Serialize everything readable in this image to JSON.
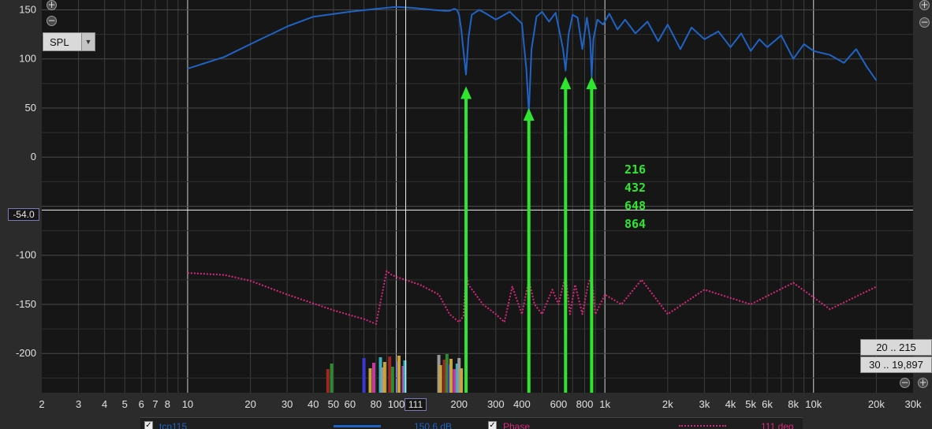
{
  "view_selector": {
    "value": "SPL"
  },
  "cursor_readout": {
    "y_value": "-54.0",
    "x_value": "111"
  },
  "range_buttons": {
    "low_band": "20 .. 215",
    "full_band": "30 .. 19,897"
  },
  "colors": {
    "spl": "#1f63c4",
    "phase": "#d8287b",
    "arrow": "#2fe62f",
    "background": "#161616"
  },
  "legend": {
    "trace_name": "tcp115",
    "trace_level": "150.6 dB",
    "phase_label": "Phase",
    "phase_value": "111 deg"
  },
  "chart_data": {
    "type": "line",
    "x_scale": "log",
    "xlim": [
      2,
      30000
    ],
    "ylim": [
      -240,
      160
    ],
    "x_tick_labels": [
      "2",
      "3",
      "4",
      "5",
      "6",
      "7",
      "8",
      "10",
      "20",
      "30",
      "40",
      "50",
      "60",
      "80",
      "100",
      "200",
      "300",
      "400",
      "600",
      "800",
      "1k",
      "2k",
      "3k",
      "4k",
      "5k",
      "6k",
      "8k",
      "10k",
      "20k",
      "30k"
    ],
    "y_tick_labels": [
      "150",
      "100",
      "50",
      "0",
      "-100",
      "-150",
      "-200"
    ],
    "grid": true,
    "annotations": [
      "216",
      "432",
      "648",
      "864"
    ],
    "arrows": [
      {
        "x": 216,
        "y_from": -240,
        "y_to": 72
      },
      {
        "x": 432,
        "y_from": -240,
        "y_to": 50
      },
      {
        "x": 648,
        "y_from": -240,
        "y_to": 82
      },
      {
        "x": 864,
        "y_from": -240,
        "y_to": 82
      }
    ],
    "series": [
      {
        "style": "solid",
        "x": [
          10,
          15,
          20,
          30,
          40,
          60,
          80,
          100,
          120,
          150,
          170,
          180,
          190,
          195,
          200,
          205,
          210,
          216,
          222,
          230,
          250,
          270,
          300,
          350,
          400,
          420,
          432,
          445,
          470,
          500,
          540,
          580,
          610,
          630,
          648,
          670,
          700,
          740,
          780,
          820,
          850,
          864,
          880,
          920,
          980,
          1050,
          1150,
          1250,
          1400,
          1600,
          1800,
          2000,
          2300,
          2600,
          3000,
          3500,
          4000,
          4500,
          5000,
          5500,
          6000,
          7000,
          8000,
          9000,
          10000,
          12000,
          14000,
          16000,
          18000,
          20000
        ],
        "y": [
          90,
          102,
          115,
          133,
          143,
          148,
          151,
          153,
          152,
          150,
          149,
          149,
          151,
          150,
          145,
          130,
          108,
          84,
          122,
          145,
          150,
          146,
          140,
          148,
          136,
          90,
          45,
          110,
          143,
          148,
          138,
          147,
          125,
          110,
          88,
          125,
          145,
          142,
          110,
          142,
          120,
          82,
          120,
          140,
          135,
          146,
          130,
          140,
          126,
          138,
          118,
          135,
          110,
          132,
          120,
          128,
          112,
          126,
          108,
          120,
          112,
          124,
          100,
          115,
          108,
          104,
          96,
          110,
          92,
          78
        ]
      },
      {
        "style": "dotted",
        "x": [
          10,
          15,
          20,
          30,
          40,
          50,
          60,
          70,
          80,
          90,
          95,
          100,
          130,
          160,
          180,
          200,
          210,
          216,
          222,
          260,
          300,
          330,
          360,
          400,
          432,
          460,
          500,
          560,
          600,
          648,
          680,
          720,
          780,
          830,
          864,
          900,
          1000,
          1200,
          1500,
          2000,
          3000,
          5000,
          8000,
          12000,
          20000
        ],
        "y": [
          -118,
          -120,
          -126,
          -140,
          -149,
          -156,
          -161,
          -165,
          -170,
          -116,
          -120,
          -122,
          -130,
          -140,
          -160,
          -168,
          -162,
          -115,
          -130,
          -150,
          -160,
          -168,
          -132,
          -160,
          -125,
          -150,
          -160,
          -135,
          -150,
          -120,
          -160,
          -130,
          -160,
          -130,
          -120,
          -160,
          -140,
          -150,
          -125,
          -160,
          -135,
          -150,
          -128,
          -155,
          -132
        ]
      }
    ],
    "histogram_bar_x": [
      47,
      49,
      70,
      75,
      78,
      84,
      86,
      88,
      93,
      96,
      102,
      103,
      108,
      110,
      160,
      163,
      170,
      175,
      180,
      183,
      190,
      196,
      200,
      205
    ]
  }
}
